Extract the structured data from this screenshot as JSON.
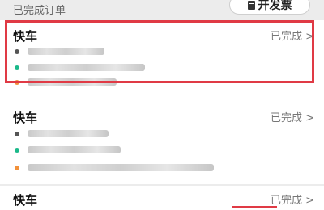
{
  "header": {
    "section_title": "已完成订单",
    "invoice_button": "开发票"
  },
  "orders": [
    {
      "type": "快车",
      "status": "已完成 >"
    },
    {
      "type": "快车",
      "status": "已完成 >"
    },
    {
      "type": "快车",
      "status": "已完成 >"
    }
  ],
  "colors": {
    "highlight": "#e03a45",
    "green_dot": "#1bb98a",
    "orange_dot": "#f2913a"
  },
  "icons": [
    "clock-icon",
    "start-dot-icon",
    "end-dot-icon",
    "invoice-icon",
    "chevron-right-icon"
  ]
}
